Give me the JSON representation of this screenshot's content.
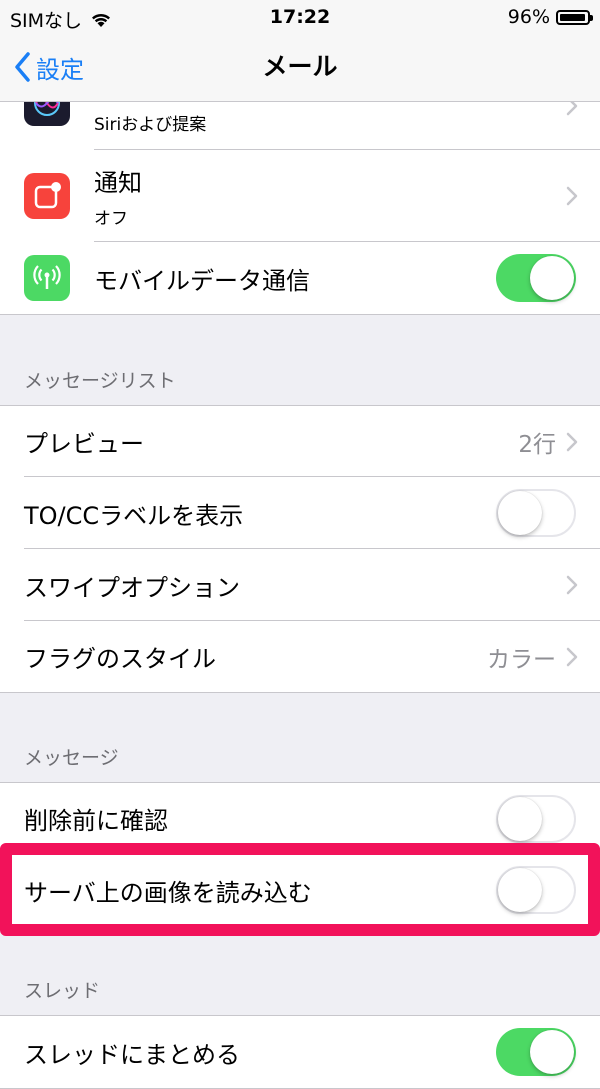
{
  "status_bar": {
    "carrier": "SIMなし",
    "time": "17:22",
    "battery": "96%",
    "battery_level": 0.96
  },
  "nav": {
    "back_label": "設定",
    "title": "メール"
  },
  "top_group": [
    {
      "label": "",
      "sublabel": "Siriおよび提案",
      "icon": "siri-icon"
    },
    {
      "label": "通知",
      "sublabel": "オフ",
      "icon": "notification-icon"
    },
    {
      "label": "モバイルデータ通信",
      "icon": "cellular-antenna-icon",
      "toggle": "on"
    }
  ],
  "message_list": {
    "header": "メッセージリスト",
    "rows": [
      {
        "label": "プレビュー",
        "value": "2行"
      },
      {
        "label": "TO/CCラベルを表示",
        "toggle": "off"
      },
      {
        "label": "スワイプオプション"
      },
      {
        "label": "フラグのスタイル",
        "value": "カラー"
      }
    ]
  },
  "messages": {
    "header": "メッセージ",
    "rows": [
      {
        "label": "削除前に確認",
        "toggle": "off"
      },
      {
        "label": "サーバ上の画像を読み込む",
        "toggle": "off"
      }
    ]
  },
  "threads": {
    "header": "スレッド",
    "rows": [
      {
        "label": "スレッドにまとめる",
        "toggle": "on"
      }
    ]
  },
  "colors": {
    "accent": "#1a7ff6",
    "toggle_on": "#4cd964",
    "highlight": "#f2125a",
    "notification_icon": "#f7433c",
    "cellular_icon": "#4cd964"
  }
}
